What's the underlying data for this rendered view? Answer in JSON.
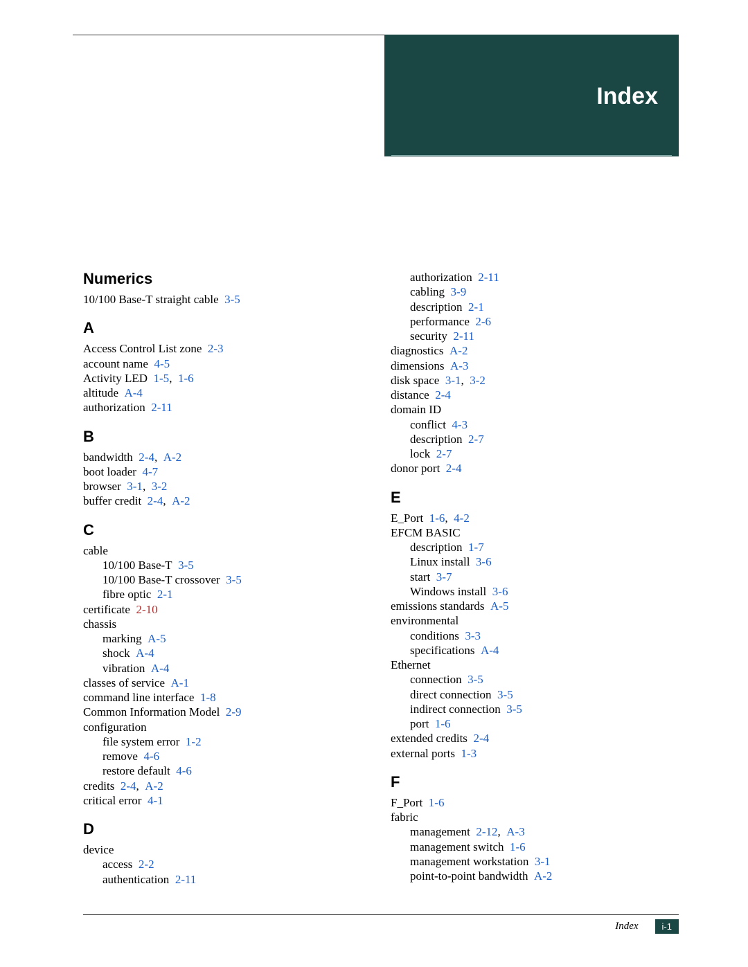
{
  "header": {
    "title": "Index"
  },
  "footer": {
    "label": "Index",
    "page": "i-1"
  },
  "sections_left": [
    {
      "heading": "Numerics",
      "items": [
        {
          "level": 0,
          "text": "10/100 Base-T straight cable",
          "refs": [
            "3-5"
          ]
        }
      ]
    },
    {
      "heading": "A",
      "items": [
        {
          "level": 0,
          "text": "Access Control List zone",
          "refs": [
            "2-3"
          ]
        },
        {
          "level": 0,
          "text": "account name",
          "refs": [
            "4-5"
          ]
        },
        {
          "level": 0,
          "text": "Activity LED",
          "refs": [
            "1-5",
            "1-6"
          ]
        },
        {
          "level": 0,
          "text": "altitude",
          "refs": [
            "A-4"
          ]
        },
        {
          "level": 0,
          "text": "authorization",
          "refs": [
            "2-11"
          ]
        }
      ]
    },
    {
      "heading": "B",
      "items": [
        {
          "level": 0,
          "text": "bandwidth",
          "refs": [
            "2-4",
            "A-2"
          ]
        },
        {
          "level": 0,
          "text": "boot loader",
          "refs": [
            "4-7"
          ]
        },
        {
          "level": 0,
          "text": "browser",
          "refs": [
            "3-1",
            "3-2"
          ]
        },
        {
          "level": 0,
          "text": "buffer credit",
          "refs": [
            "2-4",
            "A-2"
          ]
        }
      ]
    },
    {
      "heading": "C",
      "items": [
        {
          "level": 0,
          "text": "cable",
          "refs": []
        },
        {
          "level": 1,
          "text": "10/100 Base-T",
          "refs": [
            "3-5"
          ]
        },
        {
          "level": 1,
          "text": "10/100 Base-T crossover",
          "refs": [
            "3-5"
          ]
        },
        {
          "level": 1,
          "text": "fibre optic",
          "refs": [
            "2-1"
          ]
        },
        {
          "level": 0,
          "text": "certificate",
          "refs": [
            "2-10"
          ],
          "color": "red"
        },
        {
          "level": 0,
          "text": "chassis",
          "refs": []
        },
        {
          "level": 1,
          "text": "marking",
          "refs": [
            "A-5"
          ]
        },
        {
          "level": 1,
          "text": "shock",
          "refs": [
            "A-4"
          ]
        },
        {
          "level": 1,
          "text": "vibration",
          "refs": [
            "A-4"
          ]
        },
        {
          "level": 0,
          "text": "classes of service",
          "refs": [
            "A-1"
          ]
        },
        {
          "level": 0,
          "text": "command line interface",
          "refs": [
            "1-8"
          ]
        },
        {
          "level": 0,
          "text": "Common Information Model",
          "refs": [
            "2-9"
          ]
        },
        {
          "level": 0,
          "text": "configuration",
          "refs": []
        },
        {
          "level": 1,
          "text": "file system error",
          "refs": [
            "1-2"
          ]
        },
        {
          "level": 1,
          "text": "remove",
          "refs": [
            "4-6"
          ]
        },
        {
          "level": 1,
          "text": "restore default",
          "refs": [
            "4-6"
          ]
        },
        {
          "level": 0,
          "text": "credits",
          "refs": [
            "2-4",
            "A-2"
          ]
        },
        {
          "level": 0,
          "text": "critical error",
          "refs": [
            "4-1"
          ]
        }
      ]
    },
    {
      "heading": "D",
      "items": [
        {
          "level": 0,
          "text": "device",
          "refs": []
        },
        {
          "level": 1,
          "text": "access",
          "refs": [
            "2-2"
          ]
        },
        {
          "level": 1,
          "text": "authentication",
          "refs": [
            "2-11"
          ]
        }
      ]
    }
  ],
  "sections_right": [
    {
      "heading": "",
      "items": [
        {
          "level": 1,
          "text": "authorization",
          "refs": [
            "2-11"
          ]
        },
        {
          "level": 1,
          "text": "cabling",
          "refs": [
            "3-9"
          ]
        },
        {
          "level": 1,
          "text": "description",
          "refs": [
            "2-1"
          ]
        },
        {
          "level": 1,
          "text": "performance",
          "refs": [
            "2-6"
          ]
        },
        {
          "level": 1,
          "text": "security",
          "refs": [
            "2-11"
          ]
        },
        {
          "level": 0,
          "text": "diagnostics",
          "refs": [
            "A-2"
          ]
        },
        {
          "level": 0,
          "text": "dimensions",
          "refs": [
            "A-3"
          ]
        },
        {
          "level": 0,
          "text": "disk space",
          "refs": [
            "3-1",
            "3-2"
          ]
        },
        {
          "level": 0,
          "text": "distance",
          "refs": [
            "2-4"
          ]
        },
        {
          "level": 0,
          "text": "domain ID",
          "refs": []
        },
        {
          "level": 1,
          "text": "conflict",
          "refs": [
            "4-3"
          ]
        },
        {
          "level": 1,
          "text": "description",
          "refs": [
            "2-7"
          ]
        },
        {
          "level": 1,
          "text": "lock",
          "refs": [
            "2-7"
          ]
        },
        {
          "level": 0,
          "text": "donor port",
          "refs": [
            "2-4"
          ]
        }
      ]
    },
    {
      "heading": "E",
      "items": [
        {
          "level": 0,
          "text": "E_Port",
          "refs": [
            "1-6",
            "4-2"
          ]
        },
        {
          "level": 0,
          "text": "EFCM BASIC",
          "refs": []
        },
        {
          "level": 1,
          "text": "description",
          "refs": [
            "1-7"
          ]
        },
        {
          "level": 1,
          "text": "Linux install",
          "refs": [
            "3-6"
          ]
        },
        {
          "level": 1,
          "text": "start",
          "refs": [
            "3-7"
          ]
        },
        {
          "level": 1,
          "text": "Windows install",
          "refs": [
            "3-6"
          ]
        },
        {
          "level": 0,
          "text": "emissions standards",
          "refs": [
            "A-5"
          ]
        },
        {
          "level": 0,
          "text": "environmental",
          "refs": []
        },
        {
          "level": 1,
          "text": "conditions",
          "refs": [
            "3-3"
          ]
        },
        {
          "level": 1,
          "text": "specifications",
          "refs": [
            "A-4"
          ]
        },
        {
          "level": 0,
          "text": "Ethernet",
          "refs": []
        },
        {
          "level": 1,
          "text": "connection",
          "refs": [
            "3-5"
          ]
        },
        {
          "level": 1,
          "text": "direct connection",
          "refs": [
            "3-5"
          ]
        },
        {
          "level": 1,
          "text": "indirect connection",
          "refs": [
            "3-5"
          ]
        },
        {
          "level": 1,
          "text": "port",
          "refs": [
            "1-6"
          ]
        },
        {
          "level": 0,
          "text": "extended credits",
          "refs": [
            "2-4"
          ]
        },
        {
          "level": 0,
          "text": "external ports",
          "refs": [
            "1-3"
          ]
        }
      ]
    },
    {
      "heading": "F",
      "items": [
        {
          "level": 0,
          "text": "F_Port",
          "refs": [
            "1-6"
          ]
        },
        {
          "level": 0,
          "text": "fabric",
          "refs": []
        },
        {
          "level": 1,
          "text": "management",
          "refs": [
            "2-12",
            "A-3"
          ]
        },
        {
          "level": 1,
          "text": "management switch",
          "refs": [
            "1-6"
          ]
        },
        {
          "level": 1,
          "text": "management workstation",
          "refs": [
            "3-1"
          ]
        },
        {
          "level": 1,
          "text": "point-to-point bandwidth",
          "refs": [
            "A-2"
          ]
        }
      ]
    }
  ]
}
